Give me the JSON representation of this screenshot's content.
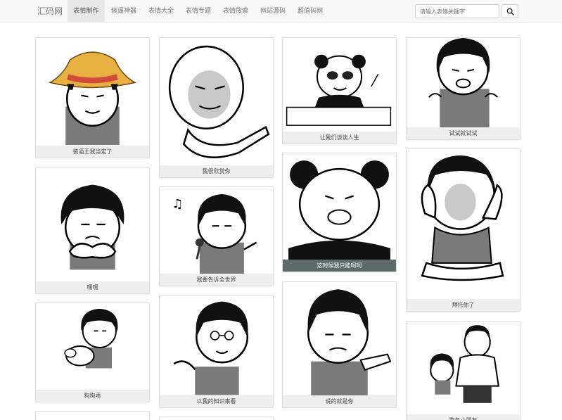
{
  "navbar": {
    "brand": "汇码网",
    "items": [
      {
        "label": "表情制作",
        "active": true
      },
      {
        "label": "装逼神器",
        "active": false
      },
      {
        "label": "表情大全",
        "active": false
      },
      {
        "label": "表情专题",
        "active": false
      },
      {
        "label": "表情搜索",
        "active": false
      },
      {
        "label": "网站源码",
        "active": false
      },
      {
        "label": "超值码网",
        "active": false
      }
    ],
    "search_placeholder": "请输入表情关键字",
    "search_icon": "search-icon"
  },
  "cards": [
    {
      "caption": "装逼王我当定了",
      "hat": true
    },
    {
      "caption": "我很欣赏你"
    },
    {
      "caption": "让我们谈谈人生",
      "panda": true
    },
    {
      "caption": "试试就试试"
    },
    {
      "caption": "嘿嘿"
    },
    {
      "caption": "我要告诉全世界"
    },
    {
      "caption": "这时候我只能呵呵",
      "panda": true,
      "highlighted": true
    },
    {
      "caption": "拜托你了"
    },
    {
      "caption": "狗狗乖"
    },
    {
      "caption": "以我的知识来看"
    },
    {
      "caption": "说的就是你"
    },
    {
      "caption": "欺负小朋友"
    }
  ],
  "colors": {
    "navbar_bg": "#f8f8f8",
    "active_nav_bg": "#e7e7e7",
    "caption_bg": "#eeeeee",
    "caption_highlight_bg": "#5d6b6b"
  }
}
